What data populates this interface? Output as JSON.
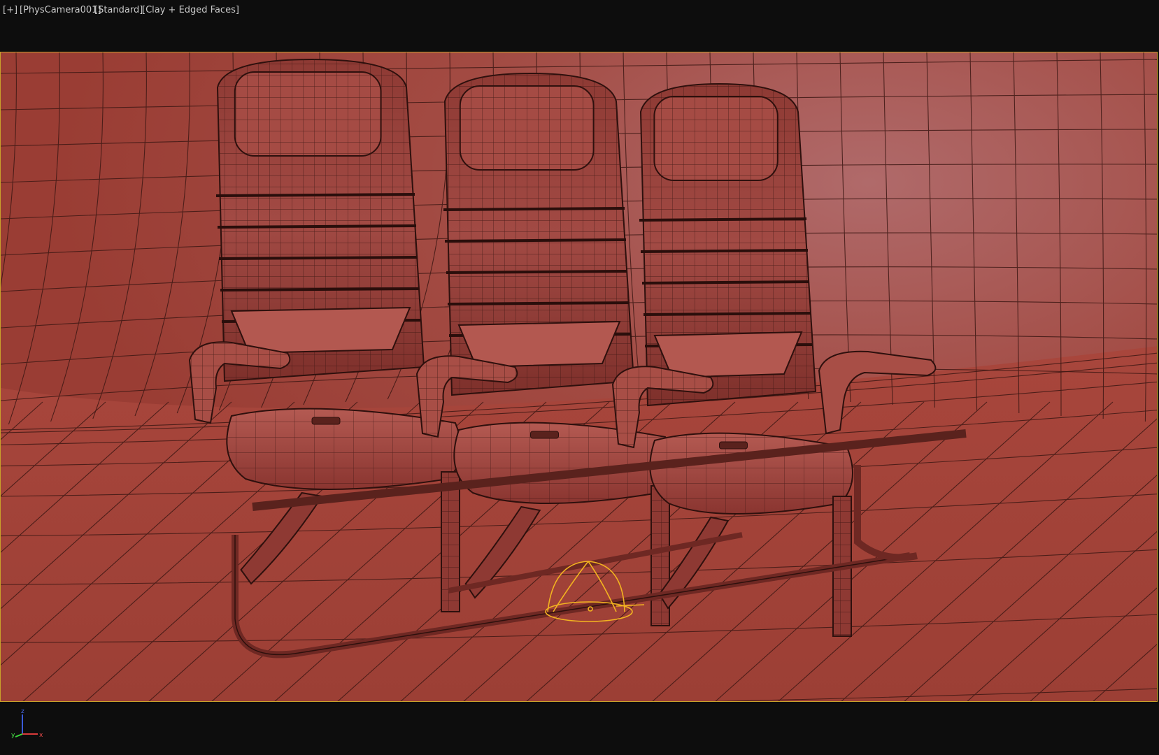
{
  "viewport": {
    "label_plus": "[+]",
    "label_camera": "[PhysCamera001]",
    "label_shading": "[Standard]",
    "label_display": "[Clay + Edged Faces]",
    "frame_color": "#c9a22a",
    "clay_color": "#9b4038",
    "wire_color": "#3a1512"
  },
  "scene": {
    "objects": [
      "seat-left",
      "seat-middle",
      "seat-right",
      "curved-backdrop",
      "camera-helper-icon"
    ]
  },
  "axis_gizmo": {
    "x_label": "x",
    "y_label": "y",
    "z_label": "z"
  }
}
